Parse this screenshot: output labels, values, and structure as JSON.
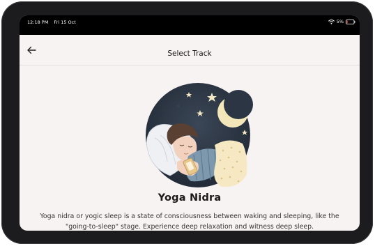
{
  "status_bar": {
    "time": "12:18 PM",
    "date": "Fri 15 Oct",
    "battery": "5%",
    "icons": [
      "wifi-icon",
      "battery-icon"
    ]
  },
  "header": {
    "title": "Select Track",
    "back_icon": "back-arrow-icon"
  },
  "track": {
    "title": "Yoga Nidra",
    "description": "Yoga nidra or yogic sleep is a state of consciousness between waking and sleeping, like the \"going-to-sleep\" stage. Experience deep relaxation and witness deep sleep.",
    "illustration": "sleeping-person-illustration"
  },
  "colors": {
    "background": "#f6f3f2",
    "night_sky": "#2a3442",
    "moon": "#f3e6b8",
    "text": "#1f1a17"
  }
}
